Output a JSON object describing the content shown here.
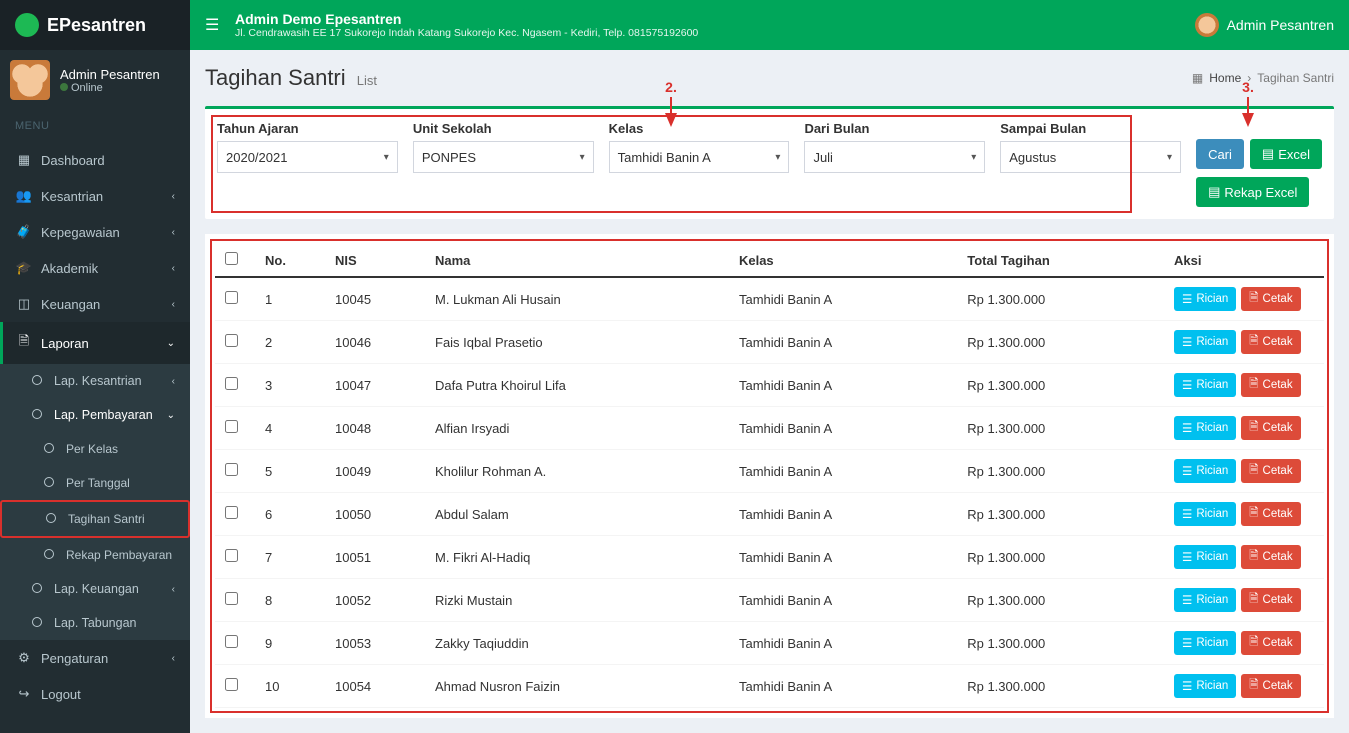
{
  "app_name": "EPesantren",
  "topbar": {
    "title": "Admin Demo Epesantren",
    "subtitle": "Jl. Cendrawasih EE 17 Sukorejo Indah Katang Sukorejo Kec. Ngasem - Kediri, Telp. 081575192600",
    "user": "Admin Pesantren"
  },
  "sidebar": {
    "user_name": "Admin Pesantren",
    "status": "Online",
    "menu_header": "MENU",
    "items": {
      "dashboard": "Dashboard",
      "kesantrian": "Kesantrian",
      "kepegawaian": "Kepegawaian",
      "akademik": "Akademik",
      "keuangan": "Keuangan",
      "laporan": "Laporan",
      "lap_kesantrian": "Lap. Kesantrian",
      "lap_pembayaran": "Lap. Pembayaran",
      "per_kelas": "Per Kelas",
      "per_tanggal": "Per Tanggal",
      "tagihan_santri": "Tagihan Santri",
      "rekap_pembayaran": "Rekap Pembayaran",
      "lap_keuangan": "Lap. Keuangan",
      "lap_tabungan": "Lap. Tabungan",
      "pengaturan": "Pengaturan",
      "logout": "Logout"
    }
  },
  "page": {
    "title": "Tagihan Santri",
    "subtitle": "List",
    "breadcrumb_home": "Home",
    "breadcrumb_current": "Tagihan Santri"
  },
  "filters": {
    "tahun_ajaran_label": "Tahun Ajaran",
    "tahun_ajaran_value": "2020/2021",
    "unit_sekolah_label": "Unit Sekolah",
    "unit_sekolah_value": "PONPES",
    "kelas_label": "Kelas",
    "kelas_value": "Tamhidi Banin A",
    "dari_bulan_label": "Dari Bulan",
    "dari_bulan_value": "Juli",
    "sampai_bulan_label": "Sampai Bulan",
    "sampai_bulan_value": "Agustus",
    "btn_cari": "Cari",
    "btn_excel": "Excel",
    "btn_rekap": "Rekap Excel"
  },
  "annotations": {
    "step2": "2.",
    "step3": "3."
  },
  "table": {
    "headers": {
      "no": "No.",
      "nis": "NIS",
      "nama": "Nama",
      "kelas": "Kelas",
      "total": "Total Tagihan",
      "aksi": "Aksi"
    },
    "btn_rician": "Rician",
    "btn_cetak": "Cetak",
    "rows": [
      {
        "no": "1",
        "nis": "10045",
        "nama": "M. Lukman Ali Husain",
        "kelas": "Tamhidi Banin A",
        "total": "Rp 1.300.000"
      },
      {
        "no": "2",
        "nis": "10046",
        "nama": "Fais Iqbal Prasetio",
        "kelas": "Tamhidi Banin A",
        "total": "Rp 1.300.000"
      },
      {
        "no": "3",
        "nis": "10047",
        "nama": "Dafa Putra Khoirul Lifa",
        "kelas": "Tamhidi Banin A",
        "total": "Rp 1.300.000"
      },
      {
        "no": "4",
        "nis": "10048",
        "nama": "Alfian Irsyadi",
        "kelas": "Tamhidi Banin A",
        "total": "Rp 1.300.000"
      },
      {
        "no": "5",
        "nis": "10049",
        "nama": "Kholilur Rohman A.",
        "kelas": "Tamhidi Banin A",
        "total": "Rp 1.300.000"
      },
      {
        "no": "6",
        "nis": "10050",
        "nama": "Abdul Salam",
        "kelas": "Tamhidi Banin A",
        "total": "Rp 1.300.000"
      },
      {
        "no": "7",
        "nis": "10051",
        "nama": "M. Fikri Al-Hadiq",
        "kelas": "Tamhidi Banin A",
        "total": "Rp 1.300.000"
      },
      {
        "no": "8",
        "nis": "10052",
        "nama": "Rizki Mustain",
        "kelas": "Tamhidi Banin A",
        "total": "Rp 1.300.000"
      },
      {
        "no": "9",
        "nis": "10053",
        "nama": "Zakky Taqiuddin",
        "kelas": "Tamhidi Banin A",
        "total": "Rp 1.300.000"
      },
      {
        "no": "10",
        "nis": "10054",
        "nama": "Ahmad Nusron Faizin",
        "kelas": "Tamhidi Banin A",
        "total": "Rp 1.300.000"
      }
    ]
  }
}
